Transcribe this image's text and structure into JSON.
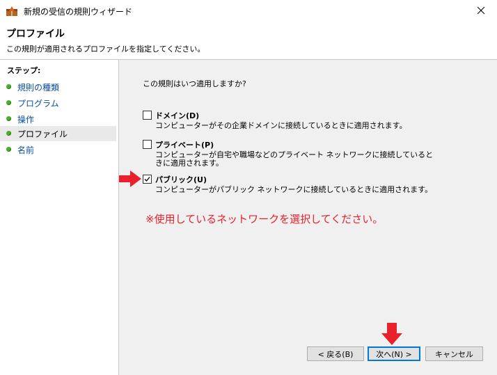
{
  "window": {
    "title": "新規の受信の規則ウィザード"
  },
  "header": {
    "title": "プロファイル",
    "description": "この規則が適用されるプロファイルを指定してください。"
  },
  "sidebar": {
    "steps_label": "ステップ:",
    "items": [
      {
        "label": "規則の種類"
      },
      {
        "label": "プログラム"
      },
      {
        "label": "操作"
      },
      {
        "label": "プロファイル"
      },
      {
        "label": "名前"
      }
    ]
  },
  "main": {
    "question": "この規則はいつ適用しますか?",
    "options": [
      {
        "label": "ドメイン(D)",
        "description": "コンピューターがその企業ドメインに接続しているときに適用されます。",
        "checked": false
      },
      {
        "label": "プライベート(P)",
        "description": "コンピューターが自宅や職場などのプライベート ネットワークに接続しているときに適用されます。",
        "checked": false
      },
      {
        "label": "パブリック(U)",
        "description": "コンピューターがパブリック ネットワークに接続しているときに適用されます。",
        "checked": true
      }
    ],
    "note": "※使用しているネットワークを選択してください。"
  },
  "buttons": {
    "back": "< 戻る(B)",
    "next": "次へ(N) >",
    "cancel": "キャンセル"
  },
  "colors": {
    "annotation": "#e8212c",
    "link": "#0a4ea1",
    "step_dot": "#4caf2b",
    "focus_border": "#0078d7"
  }
}
